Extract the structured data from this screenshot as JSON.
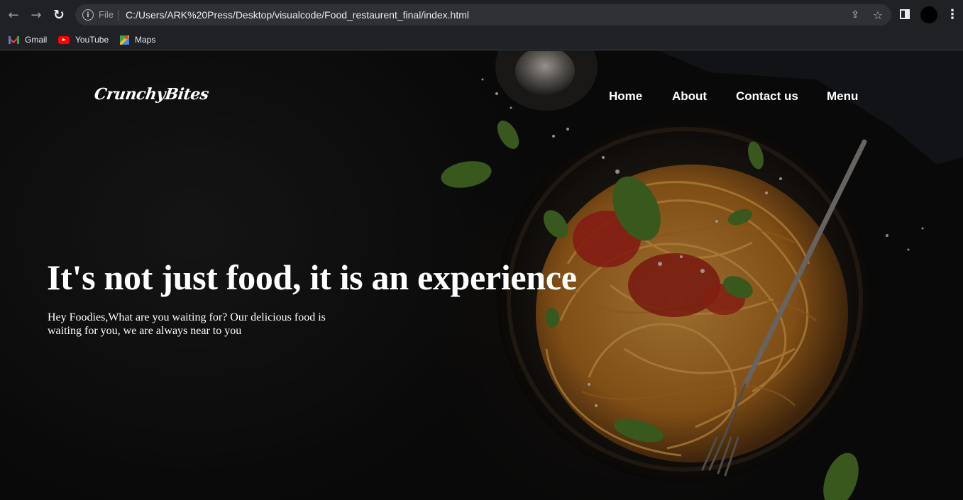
{
  "browser": {
    "file_label": "File",
    "url": "C:/Users/ARK%20Press/Desktop/visualcode/Food_restaurent_final/index.html",
    "bookmarks": [
      {
        "label": "Gmail",
        "icon": "gmail-icon"
      },
      {
        "label": "YouTube",
        "icon": "youtube-icon"
      },
      {
        "label": "Maps",
        "icon": "maps-icon"
      }
    ]
  },
  "site": {
    "logo": "CrunchyBites",
    "nav": [
      {
        "label": "Home"
      },
      {
        "label": "About"
      },
      {
        "label": "Contact us"
      },
      {
        "label": "Menu"
      }
    ],
    "hero": {
      "headline": "It's not just food, it is an experience",
      "subline": "Hey Foodies,What are you waiting for? Our delicious food is waiting for you, we are always near to you"
    }
  },
  "colors": {
    "chrome_bg": "#202124",
    "omnibox_bg": "#303134",
    "page_bg": "#111111",
    "text": "#ffffff",
    "pasta": "#d98a2b",
    "sauce": "#b5281c",
    "basil": "#4f7a2a"
  }
}
